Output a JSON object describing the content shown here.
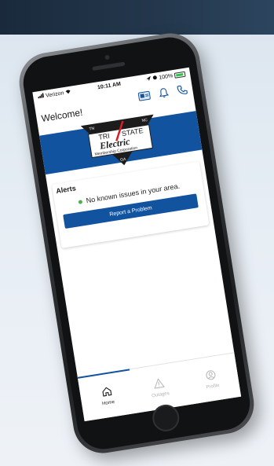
{
  "status_bar": {
    "carrier": "Verizon",
    "time": "10:11 AM",
    "battery": "100%"
  },
  "header": {
    "greeting": "Welcome!",
    "icons": [
      "card-icon",
      "bell-icon",
      "phone-icon"
    ]
  },
  "logo": {
    "text_tri": "TRI",
    "text_state": "STATE",
    "text_electric": "Electric",
    "text_sub": "Membership Corporation",
    "corner_tn": "TN",
    "corner_nc": "NC",
    "corner_ga": "GA"
  },
  "alerts": {
    "title": "Alerts",
    "status_text": "No known issues in your area.",
    "status_color": "#4caf50",
    "report_button": "Report a Problem"
  },
  "tabs": [
    {
      "label": "Home",
      "icon": "home-icon",
      "active": true
    },
    {
      "label": "Outages",
      "icon": "warning-icon",
      "active": false
    },
    {
      "label": "Profile",
      "icon": "profile-icon",
      "active": false
    }
  ],
  "colors": {
    "brand_blue": "#11539f",
    "accent_red": "#d32026"
  }
}
